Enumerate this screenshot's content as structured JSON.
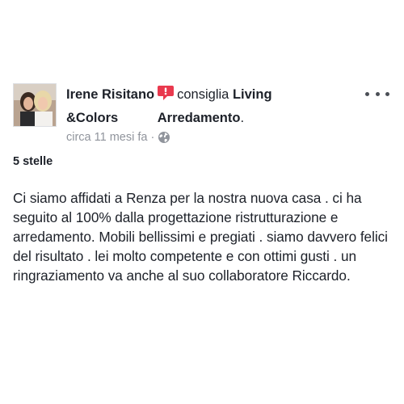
{
  "post": {
    "author_name": "Irene Risitano",
    "action_verb": "consiglia",
    "page_name_line1": "Living",
    "page_name_line2": "&Colors",
    "page_name_line3": "Arredamento",
    "page_name_suffix": ".",
    "timestamp": "circa 11 mesi fa",
    "separator": "·",
    "privacy_icon": "globe-icon",
    "recommend_icon": "recommend-speech-bubble-icon",
    "more_icon": "more-options-icon",
    "rating_label": "5 stelle",
    "review_text": "Ci siamo affidati a Renza per la nostra nuova casa . ci ha seguito al 100% dalla progettazione ristrutturazione e arredamento. Mobili bellissimi e pregiati . siamo davvero felici del risultato . lei molto competente e con ottimi gusti . un ringraziamento va anche al suo collaboratore Riccardo."
  },
  "colors": {
    "text_primary": "#1d2129",
    "text_secondary": "#90949c",
    "recommend_red": "#e9394e",
    "background": "#ffffff"
  }
}
